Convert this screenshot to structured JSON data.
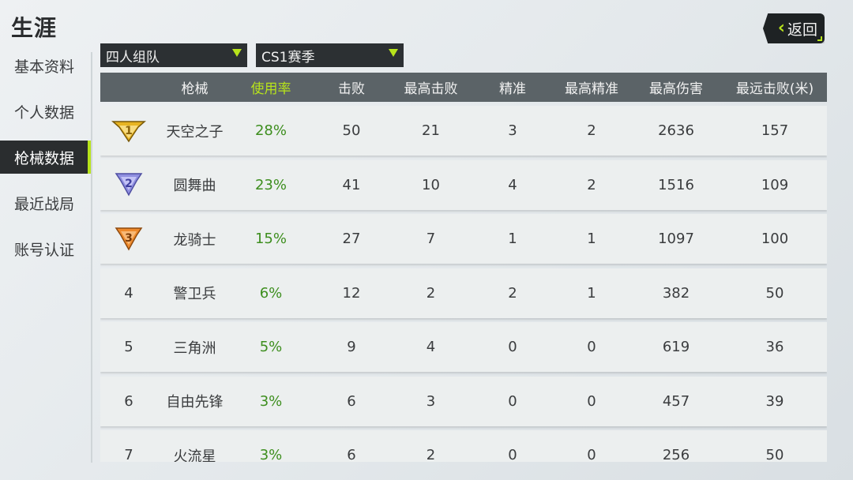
{
  "page": {
    "title": "生涯",
    "back_label": "返回"
  },
  "sidebar": {
    "items": [
      {
        "label": "基本资料",
        "active": false
      },
      {
        "label": "个人数据",
        "active": false
      },
      {
        "label": "枪械数据",
        "active": true
      },
      {
        "label": "最近战局",
        "active": false
      },
      {
        "label": "账号认证",
        "active": false
      }
    ]
  },
  "filters": {
    "mode": "四人组队",
    "season": "CS1赛季"
  },
  "table": {
    "headers": [
      "",
      "枪械",
      "使用率",
      "击败",
      "最高击败",
      "精准",
      "最高精准",
      "最高伤害",
      "最远击败(米)"
    ],
    "rows": [
      {
        "rank": "1",
        "gun": "天空之子",
        "usage": "28%",
        "kills": "50",
        "max_kills": "21",
        "accuracy": "3",
        "max_accuracy": "2",
        "max_damage": "2636",
        "max_distance": "157"
      },
      {
        "rank": "2",
        "gun": "圆舞曲",
        "usage": "23%",
        "kills": "41",
        "max_kills": "10",
        "accuracy": "4",
        "max_accuracy": "2",
        "max_damage": "1516",
        "max_distance": "109"
      },
      {
        "rank": "3",
        "gun": "龙骑士",
        "usage": "15%",
        "kills": "27",
        "max_kills": "7",
        "accuracy": "1",
        "max_accuracy": "1",
        "max_damage": "1097",
        "max_distance": "100"
      },
      {
        "rank": "4",
        "gun": "警卫兵",
        "usage": "6%",
        "kills": "12",
        "max_kills": "2",
        "accuracy": "2",
        "max_accuracy": "1",
        "max_damage": "382",
        "max_distance": "50"
      },
      {
        "rank": "5",
        "gun": "三角洲",
        "usage": "5%",
        "kills": "9",
        "max_kills": "4",
        "accuracy": "0",
        "max_accuracy": "0",
        "max_damage": "619",
        "max_distance": "36"
      },
      {
        "rank": "6",
        "gun": "自由先锋",
        "usage": "3%",
        "kills": "6",
        "max_kills": "3",
        "accuracy": "0",
        "max_accuracy": "0",
        "max_damage": "457",
        "max_distance": "39"
      },
      {
        "rank": "7",
        "gun": "火流星",
        "usage": "3%",
        "kills": "6",
        "max_kills": "2",
        "accuracy": "0",
        "max_accuracy": "0",
        "max_damage": "256",
        "max_distance": "50"
      }
    ]
  },
  "colors": {
    "accent": "#b7e31b",
    "usage": "#3d8e1e",
    "gold": "#e7b422",
    "silver": "#8f8fe0",
    "bronze": "#ee8a2c"
  },
  "icons": {
    "back": "chevron-left-icon",
    "dropdown": "triangle-down-icon",
    "rank1": "gold-medal-icon",
    "rank2": "silver-medal-icon",
    "rank3": "bronze-medal-icon"
  }
}
